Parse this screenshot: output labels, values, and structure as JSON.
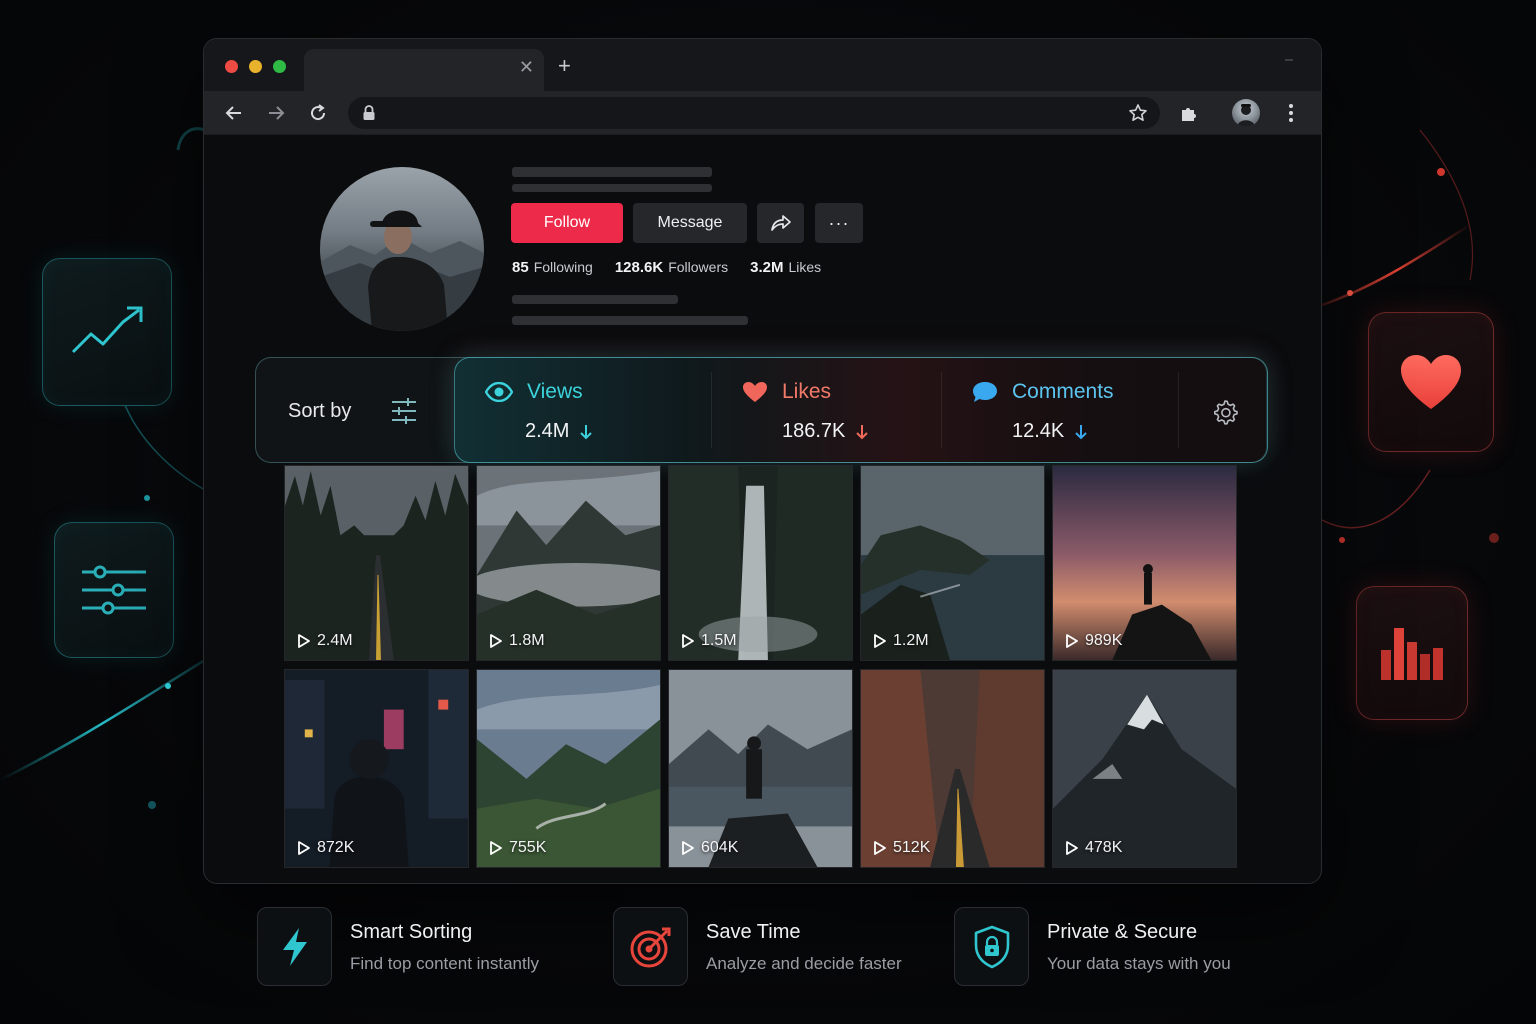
{
  "colors": {
    "accent_teal": "#2fc6d0",
    "accent_red": "#ee2a4b",
    "comments_blue": "#3aa8ee",
    "likes_red": "#f06a5a"
  },
  "browser": {
    "tab_close_icon": "close-icon",
    "new_tab_label": "+"
  },
  "profile": {
    "follow_label": "Follow",
    "message_label": "Message",
    "more_label": "···",
    "stats": [
      {
        "value": "85",
        "label": "Following"
      },
      {
        "value": "128.6K",
        "label": "Followers"
      },
      {
        "value": "3.2M",
        "label": "Likes"
      }
    ]
  },
  "sort": {
    "label": "Sort by",
    "metrics": [
      {
        "name": "Views",
        "value": "2.4M",
        "icon": "eye-icon"
      },
      {
        "name": "Likes",
        "value": "186.7K",
        "icon": "heart-icon"
      },
      {
        "name": "Comments",
        "value": "12.4K",
        "icon": "chat-bubble-icon"
      }
    ]
  },
  "videos": [
    {
      "views": "2.4M",
      "scene": "forest-road"
    },
    {
      "views": "1.8M",
      "scene": "misty-mountains"
    },
    {
      "views": "1.5M",
      "scene": "waterfall"
    },
    {
      "views": "1.2M",
      "scene": "coastal-cliffs"
    },
    {
      "views": "989K",
      "scene": "sunset-silhouette"
    },
    {
      "views": "872K",
      "scene": "neon-city"
    },
    {
      "views": "755K",
      "scene": "green-valley"
    },
    {
      "views": "604K",
      "scene": "lake-figure"
    },
    {
      "views": "512K",
      "scene": "canyon-road"
    },
    {
      "views": "478K",
      "scene": "snowy-peak"
    }
  ],
  "features": [
    {
      "title": "Smart Sorting",
      "subtitle": "Find top content instantly",
      "icon": "lightning-icon"
    },
    {
      "title": "Save Time",
      "subtitle": "Analyze and decide faster",
      "icon": "target-icon"
    },
    {
      "title": "Private & Secure",
      "subtitle": "Your data stays with you",
      "icon": "shield-lock-icon"
    }
  ]
}
